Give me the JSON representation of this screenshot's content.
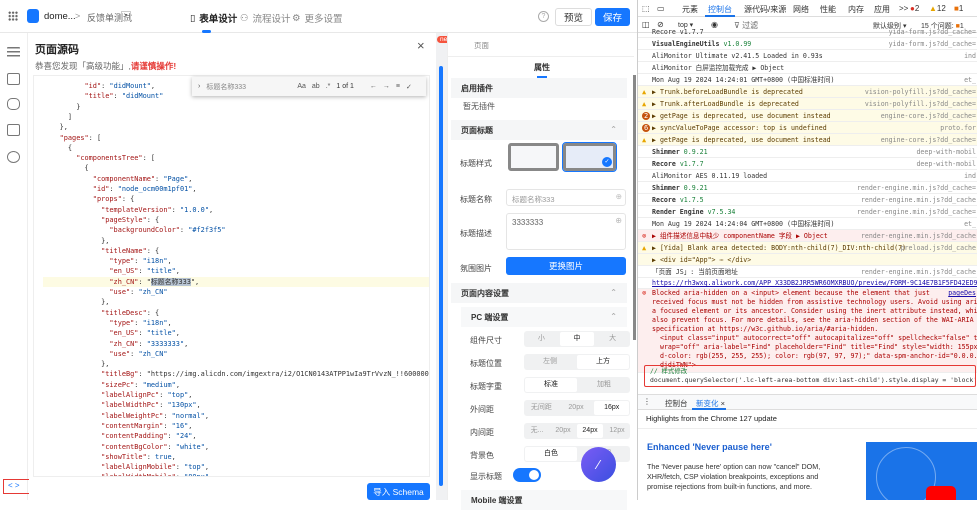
{
  "topbar": {
    "app_name": "dome...",
    "breadcrumb_sep": ">",
    "form_name": "反馈单测试",
    "tabs": [
      "表单设计",
      "流程设计",
      "更多设置"
    ],
    "preview": "预览",
    "save": "保存",
    "accent": "#1677ff"
  },
  "dialog": {
    "title": "页面源码",
    "subtitle": "恭喜您发现「高级功能」,",
    "warning": "请谨慎操作!",
    "import_button": "导入 Schema",
    "toggle_code": "< >",
    "find": {
      "value": "标题名称333",
      "case": "Aa",
      "word": "ab",
      "regex": ".*",
      "count": "1 of 1"
    },
    "code_lines": [
      "          \"id\": \"didMount\",",
      "          \"title\": \"didMount\"",
      "        }",
      "      ]",
      "    },",
      "    \"pages\": [",
      "      {",
      "        \"componentsTree\": [",
      "          {",
      "            \"componentName\": \"Page\",",
      "            \"id\": \"node_ocm00m1pf01\",",
      "            \"props\": {",
      "              \"templateVersion\": \"1.0.0\",",
      "              \"pageStyle\": {",
      "                \"backgroundColor\": \"#f2f3f5\"",
      "              },",
      "              \"titleName\": {",
      "                \"type\": \"i18n\",",
      "                \"en_US\": \"title\",",
      "                \"zh_CN\": \"标题名称333\",",
      "                \"use\": \"zh_CN\"",
      "              },",
      "              \"titleDesc\": {",
      "                \"type\": \"i18n\",",
      "                \"en_US\": \"title\",",
      "                \"zh_CN\": \"3333333\",",
      "                \"use\": \"zh_CN\"",
      "              },",
      "              \"titleBg\": \"https://img.alicdn.com/imgextra/i2/O1CN0143ATPP1wIa9TrVvzN_!!6000000",
      "              \"sizePc\": \"medium\",",
      "              \"labelAlignPc\": \"top\",",
      "              \"labelWidthPc\": \"130px\",",
      "              \"labelWeightPc\": \"normal\",",
      "              \"contentMargin\": \"16\",",
      "              \"contentPadding\": \"24\",",
      "              \"contentBgColor\": \"white\",",
      "              \"showTitle\": true,",
      "              \"labelAlignMobile\": \"top\",",
      "              \"labelWidthMobile\": \"80px\","
    ]
  },
  "props": {
    "new_badge": "new",
    "breadcrumb": "页面",
    "tab": "属性",
    "plugins_header": "启用插件",
    "no_plugins": "暂无插件",
    "page_title_header": "页面标题",
    "title_style": "标题样式",
    "title_name": "标题名称",
    "title_name_value": "标题名称333",
    "title_desc": "标题描述",
    "title_desc_value": "3333333",
    "bg_image": "氛围图片",
    "change_image": "更换图片",
    "content_header": "页面内容设置",
    "pc_header": "PC 端设置",
    "rows": [
      {
        "label": "组件尺寸",
        "options": [
          "小",
          "中",
          "大"
        ],
        "selected": 1
      },
      {
        "label": "标题位置",
        "options": [
          "左侧",
          "上方"
        ],
        "selected": 1
      },
      {
        "label": "标题字重",
        "options": [
          "标准",
          "加粗"
        ],
        "selected": 0
      },
      {
        "label": "外间距",
        "options": [
          "无间距",
          "20px",
          "16px"
        ],
        "selected": 2
      },
      {
        "label": "内间距",
        "options": [
          "无...",
          "20px",
          "24px",
          "12px"
        ],
        "selected": 2
      },
      {
        "label": "背景色",
        "options": [
          "白色",
          "透明"
        ],
        "selected": 0
      }
    ],
    "show_title": "显示标题",
    "show_title_on": true,
    "mobile_header": "Mobile 端设置"
  },
  "devtools": {
    "tabs": [
      "元素",
      "控制台",
      "源代码/来源",
      "网络",
      "性能",
      "内存",
      "应用",
      ">>"
    ],
    "errors": "2",
    "warnings": "12",
    "info": "1",
    "context": "top ▾",
    "filter": "过滤",
    "level": "默认级别 ▾",
    "issues": "15 个问题:",
    "issues_count": "1",
    "console": [
      {
        "t": "log",
        "m": "Recore v1.7.7",
        "src": "yida-form.js?dd_cache="
      },
      {
        "t": "log",
        "b": "VisualEngineUtils",
        "v": "v1.0.99",
        "src": "yida-form.js?dd_cache="
      },
      {
        "t": "log",
        "m": "AliMonitor Ultimate v2.41.5 Loaded in 0.93s",
        "src": "ind"
      },
      {
        "t": "log",
        "m": "AliMonitor 白屏监控加载完成  ▶ Object",
        "src": ""
      },
      {
        "t": "log",
        "m": "Mon Aug 19 2024 14:24:01 GMT+0800 (中国标准时间)",
        "src": "et_"
      },
      {
        "t": "warn",
        "m": "▶ Trunk.beforeLoadBundle is deprecated",
        "src": "vision-polyfill.js?dd_cache="
      },
      {
        "t": "warn",
        "m": "▶ Trunk.afterLoadBundle is deprecated",
        "src": "vision-polyfill.js?dd_cache="
      },
      {
        "t": "warn",
        "n": "2",
        "m": "▶ getPage is deprecated, use document instead",
        "src": "engine-core.js?dd_cache="
      },
      {
        "t": "warn",
        "n": "6",
        "m": "▶ syncValueToPage accessor: top is undefined",
        "src": "proto.for"
      },
      {
        "t": "warn",
        "m": "▶ getPage is deprecated, use document instead",
        "src": "engine-core.js?dd_cache="
      },
      {
        "t": "log",
        "b": "Shimmer",
        "v": "0.9.21",
        "src": "deep-with-mobil"
      },
      {
        "t": "log",
        "b": "Recore",
        "v": "v1.7.7",
        "src": "deep-with-mobil"
      },
      {
        "t": "log",
        "m": "AliMonitor AES 0.11.19 loaded",
        "src": "ind"
      },
      {
        "t": "log",
        "b": "Shimmer",
        "v": "0.9.21",
        "src": "render-engine.min.js?dd_cache="
      },
      {
        "t": "log",
        "b": "Recore",
        "v": "v1.7.5",
        "src": "render-engine.min.js?dd_cache"
      },
      {
        "t": "log",
        "b": "Render Engine",
        "v": "v7.5.34",
        "src": "render-engine.min.js?dd_cache="
      },
      {
        "t": "log",
        "m": "Mon Aug 19 2024 14:24:04 GMT+0800 (中国标准时间)",
        "src": "et_"
      },
      {
        "t": "err",
        "m": "▶ 组件描述信息中缺少 componentName 字段  ▶ Object",
        "src": "render-engine.min.js?dd_cache"
      },
      {
        "t": "warn",
        "m": "▶ [Yida] Blank area detected: BODY:nth-child(7)_DIV:nth-child(7)",
        "src": "preload.js?dd_cache"
      },
      {
        "t": "warn2",
        "m": "▶ <div id=\"App\"> ⋯ </div>",
        "src": ""
      },
      {
        "t": "log",
        "m": "「页面 JS」: 当前页面地址",
        "src": "render-engine.min.js?dd_cache"
      },
      {
        "t": "link",
        "m": "https://rh3wxq.aliwork.com/APP_X33DB2JRR5WR6OMXRBUO/preview/FORM-9C14E7B1F5FD42ED971CE",
        "src": ""
      }
    ],
    "blocked": [
      "Blocked aria-hidden on a <input> element because the element that just",
      "received focus must not be hidden from assistive technology users. Avoid using aria-hid",
      "a focused element or its ancestor. Consider using the inert attribute instead, which w",
      "also prevent focus. For more details, see the aria-hidden section of the WAI-ARIA",
      "specification at https://w3c.github.io/aria/#aria-hidden.",
      "  <input class=\"input\" autocorrect=\"off\" autocapitalize=\"off\" spellcheck=\"false\" type=",
      "  wrap=\"off\" aria-label=\"Find\" placeholder=\"Find\" title=\"Find\" style=\"width: 155px; ba",
      "  d-color: rgb(255, 255, 255); color: rgb(97, 97, 97);\" data-spm-anchor-id=\"0.0.0.110.",
      "  djdiTWN\">"
    ],
    "blocked_src": "pageDes",
    "input_comment": "// 样式修改",
    "input_code": "document.querySelector('.lc-left-area-bottom div:last-child').style.display = 'block'",
    "drawer_tabs": [
      "控制台",
      "新变化"
    ],
    "highlights": "Highlights from the Chrome 127 update",
    "whatsnew_title": "Enhanced 'Never pause here'",
    "whatsnew_body": "The 'Never pause here' option can now \"cancel\" DOM, XHR/fetch, CSP violation breakpoints, exceptions and promise rejections from built-in functions, and more."
  }
}
